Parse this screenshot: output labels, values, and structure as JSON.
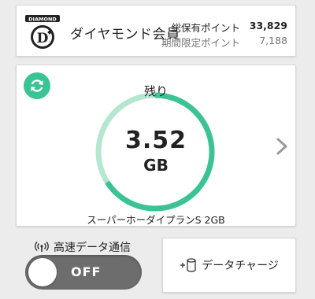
{
  "member": {
    "badge_text": "DIAMOND",
    "rank": "ダイヤモンド会員",
    "total_points_label": "総保有ポイント",
    "total_points": "33,829",
    "limited_points_label": "期間限定ポイント",
    "limited_points": "7,188"
  },
  "data": {
    "remaining_label": "残り",
    "remaining_amount": "3.52",
    "remaining_unit": "GB",
    "remaining_fraction": 0.66,
    "plan_name": "スーパーホーダイプランS 2GB"
  },
  "highspeed": {
    "label": "高速データ通信",
    "state": "OFF"
  },
  "charge": {
    "label": "データチャージ"
  },
  "colors": {
    "accent": "#3cc395",
    "accent_light": "#b4e6d0",
    "toggle_off": "#6d6d6d"
  }
}
